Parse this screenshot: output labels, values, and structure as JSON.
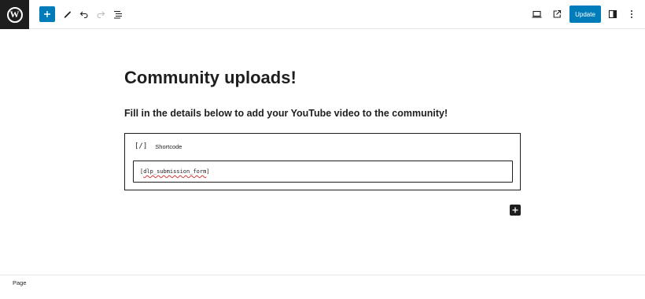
{
  "toolbar": {
    "logo_letter": "W",
    "update_label": "Update"
  },
  "content": {
    "title": "Community uploads!",
    "subheading": "Fill in the details below to add your YouTube video to the community!",
    "shortcode_block": {
      "icon_text": "[/]",
      "label": "Shortcode",
      "prefix": "[",
      "value": "dlp_submission_form",
      "suffix": "]"
    }
  },
  "footer": {
    "breadcrumb": "Page"
  },
  "colors": {
    "accent": "#007cba",
    "dark": "#1e1e1e",
    "spellcheck": "#d63638"
  }
}
